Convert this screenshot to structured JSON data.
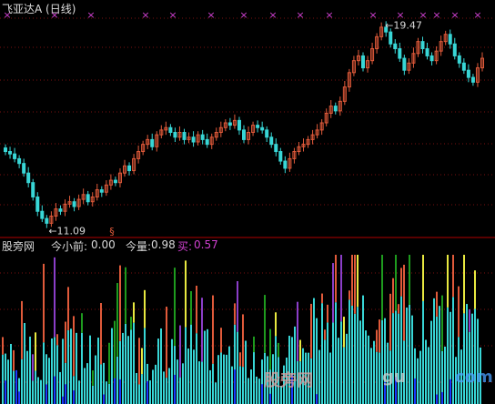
{
  "colors": {
    "up": "#e05a3a",
    "down": "#38d6d6",
    "magenta": "#d040d0",
    "grid": "#7a1010",
    "divider": "#b00000",
    "green": "#1e9b1e",
    "yellow": "#e8e840",
    "blue": "#1a3aff",
    "purple": "#8b3ec8",
    "text": "#d9d9d9"
  },
  "title": "飞亚达A (日线)",
  "price": {
    "high_label": "19.47",
    "low_label": "11.09",
    "marker_glyph": "§",
    "cross_marks": [
      "×",
      "×",
      "×",
      "×",
      "×",
      "×",
      "×",
      "×",
      "×",
      "×",
      "×",
      "×",
      "×",
      "×",
      "×",
      "×"
    ]
  },
  "indicator": {
    "name": "股旁网",
    "label1": "今小前:",
    "value1": "0.00",
    "label2": "今量:",
    "value2": "0.98",
    "label3": "买:",
    "value3": "0.57"
  },
  "watermark": {
    "text1": "股旁网",
    "text2": "gu",
    "text3": "com"
  },
  "chart_data": [
    {
      "type": "candlestick",
      "title": "飞亚达A (日线)",
      "ylim": [
        11.0,
        19.6
      ],
      "close": [
        14.1,
        14.0,
        13.8,
        13.6,
        13.2,
        12.8,
        12.2,
        11.6,
        11.3,
        11.1,
        11.4,
        11.7,
        11.6,
        11.9,
        12.0,
        11.8,
        12.1,
        12.3,
        12.0,
        12.2,
        12.5,
        12.4,
        12.7,
        12.9,
        12.8,
        13.2,
        13.5,
        13.3,
        13.8,
        14.1,
        14.4,
        14.6,
        14.3,
        14.8,
        15.0,
        15.1,
        14.9,
        14.7,
        14.9,
        14.6,
        14.7,
        14.5,
        14.8,
        14.6,
        14.4,
        14.7,
        14.9,
        15.1,
        15.3,
        15.2,
        15.4,
        15.0,
        14.6,
        14.9,
        15.2,
        15.1,
        15.0,
        14.7,
        14.4,
        14.1,
        13.7,
        13.4,
        13.8,
        14.1,
        14.3,
        14.4,
        14.6,
        14.8,
        15.0,
        15.3,
        15.7,
        16.0,
        15.8,
        16.2,
        16.8,
        17.4,
        17.9,
        18.1,
        17.6,
        17.9,
        18.4,
        18.9,
        19.3,
        19.1,
        18.6,
        18.4,
        18.0,
        17.5,
        17.8,
        18.2,
        18.7,
        18.4,
        18.1,
        17.9,
        18.3,
        18.7,
        19.0,
        18.6,
        18.1,
        17.8,
        17.5,
        17.2,
        17.0,
        17.6,
        18.0
      ],
      "high_point": 19.47,
      "low_point": 11.09
    },
    {
      "type": "bar",
      "legend": [
        "今小前 0.00",
        "今量 0.98",
        "买 0.57"
      ]
    }
  ]
}
